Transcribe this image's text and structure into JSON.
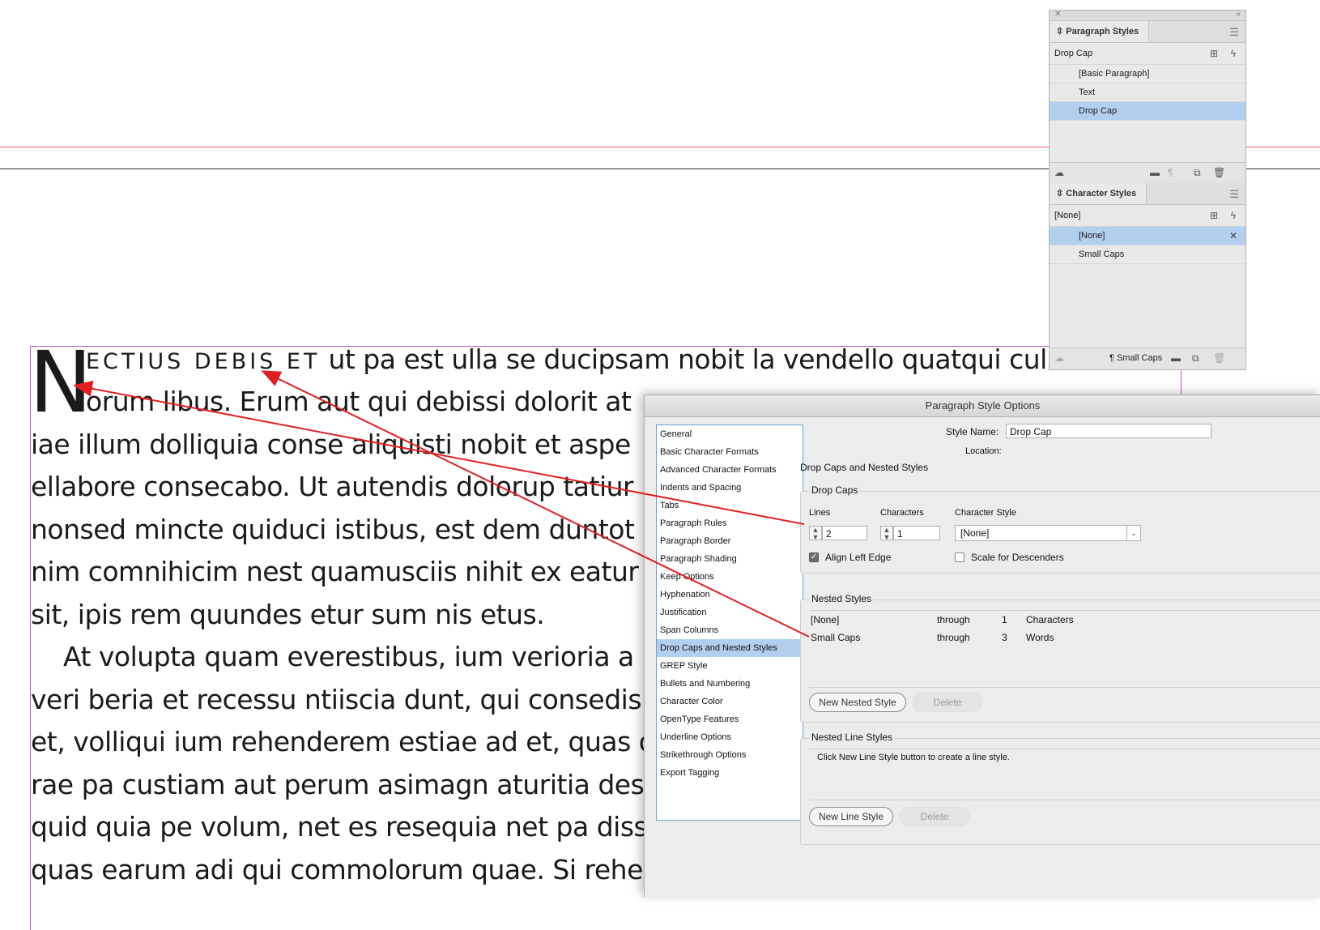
{
  "document": {
    "lines": [
      "orum libus. Erum aut qui debissi dolorit at",
      "iae illum dolliquia conse aliquisti nobit et aspe",
      "ellabore consecabo. Ut autendis dolorup tatiur",
      "nonsed mincte quiduci istibus, est dem duntot",
      "nim comnihicim nest quamusciis nihit ex eatur",
      "sit, ipis rem quundes etur sum nis etus.",
      "    At volupta quam everestibus, ium verioria a",
      "veri beria et recessu ntiiscia dunt, qui consedis",
      "et, volliqui ium rehenderem estiae ad et, quas d",
      "rae pa custiam aut perum asimagn aturitia des",
      "quid quia pe volum, net es resequia net pa diss",
      "quas earum adi qui commolorum quae. Si rehe"
    ],
    "drop_cap": "N",
    "small_caps": "ECTIUS DEBIS ET",
    "first_line_rest": " ut pa est ulla se ducipsam nobit la vendello quatqui cullia"
  },
  "paragraph_styles_panel": {
    "title": "Paragraph Styles",
    "current": "Drop Cap",
    "items": [
      {
        "label": "[Basic Paragraph]",
        "selected": false
      },
      {
        "label": "Text",
        "selected": false
      },
      {
        "label": "Drop Cap",
        "selected": true
      }
    ]
  },
  "character_styles_panel": {
    "title": "Character Styles",
    "current": "[None]",
    "items": [
      {
        "label": "[None]",
        "selected": true
      },
      {
        "label": "Small Caps",
        "selected": false
      }
    ],
    "footer_label": "¶ Small Caps"
  },
  "dialog": {
    "title": "Paragraph Style Options",
    "nav": [
      "General",
      "Basic Character Formats",
      "Advanced Character Formats",
      "Indents and Spacing",
      "Tabs",
      "Paragraph Rules",
      "Paragraph Border",
      "Paragraph Shading",
      "Keep Options",
      "Hyphenation",
      "Justification",
      "Span Columns",
      "Drop Caps and Nested Styles",
      "GREP Style",
      "Bullets and Numbering",
      "Character Color",
      "OpenType Features",
      "Underline Options",
      "Strikethrough Options",
      "Export Tagging"
    ],
    "selected_nav": "Drop Caps and Nested Styles",
    "style_name_label": "Style Name:",
    "style_name_value": "Drop Cap",
    "location_label": "Location:",
    "section_heading": "Drop Caps and Nested Styles",
    "drop_caps": {
      "title": "Drop Caps",
      "lines_label": "Lines",
      "lines_value": "2",
      "characters_label": "Characters",
      "characters_value": "1",
      "char_style_label": "Character Style",
      "char_style_value": "[None]",
      "align_left_edge": "Align Left Edge",
      "scale_descenders": "Scale for Descenders"
    },
    "nested_styles": {
      "title": "Nested Styles",
      "rows": [
        {
          "style": "[None]",
          "through": "through",
          "count": "1",
          "unit": "Characters"
        },
        {
          "style": "Small Caps",
          "through": "through",
          "count": "3",
          "unit": "Words"
        }
      ],
      "new_button": "New Nested Style",
      "delete_button": "Delete"
    },
    "nested_line_styles": {
      "title": "Nested Line Styles",
      "hint": "Click New Line Style button to create a line style.",
      "new_button": "New Line Style",
      "delete_button": "Delete"
    }
  },
  "colors": {
    "annotation_arrow": "#e02020",
    "selection": "#b3cff0",
    "frame_edge": "#c05ac0"
  }
}
